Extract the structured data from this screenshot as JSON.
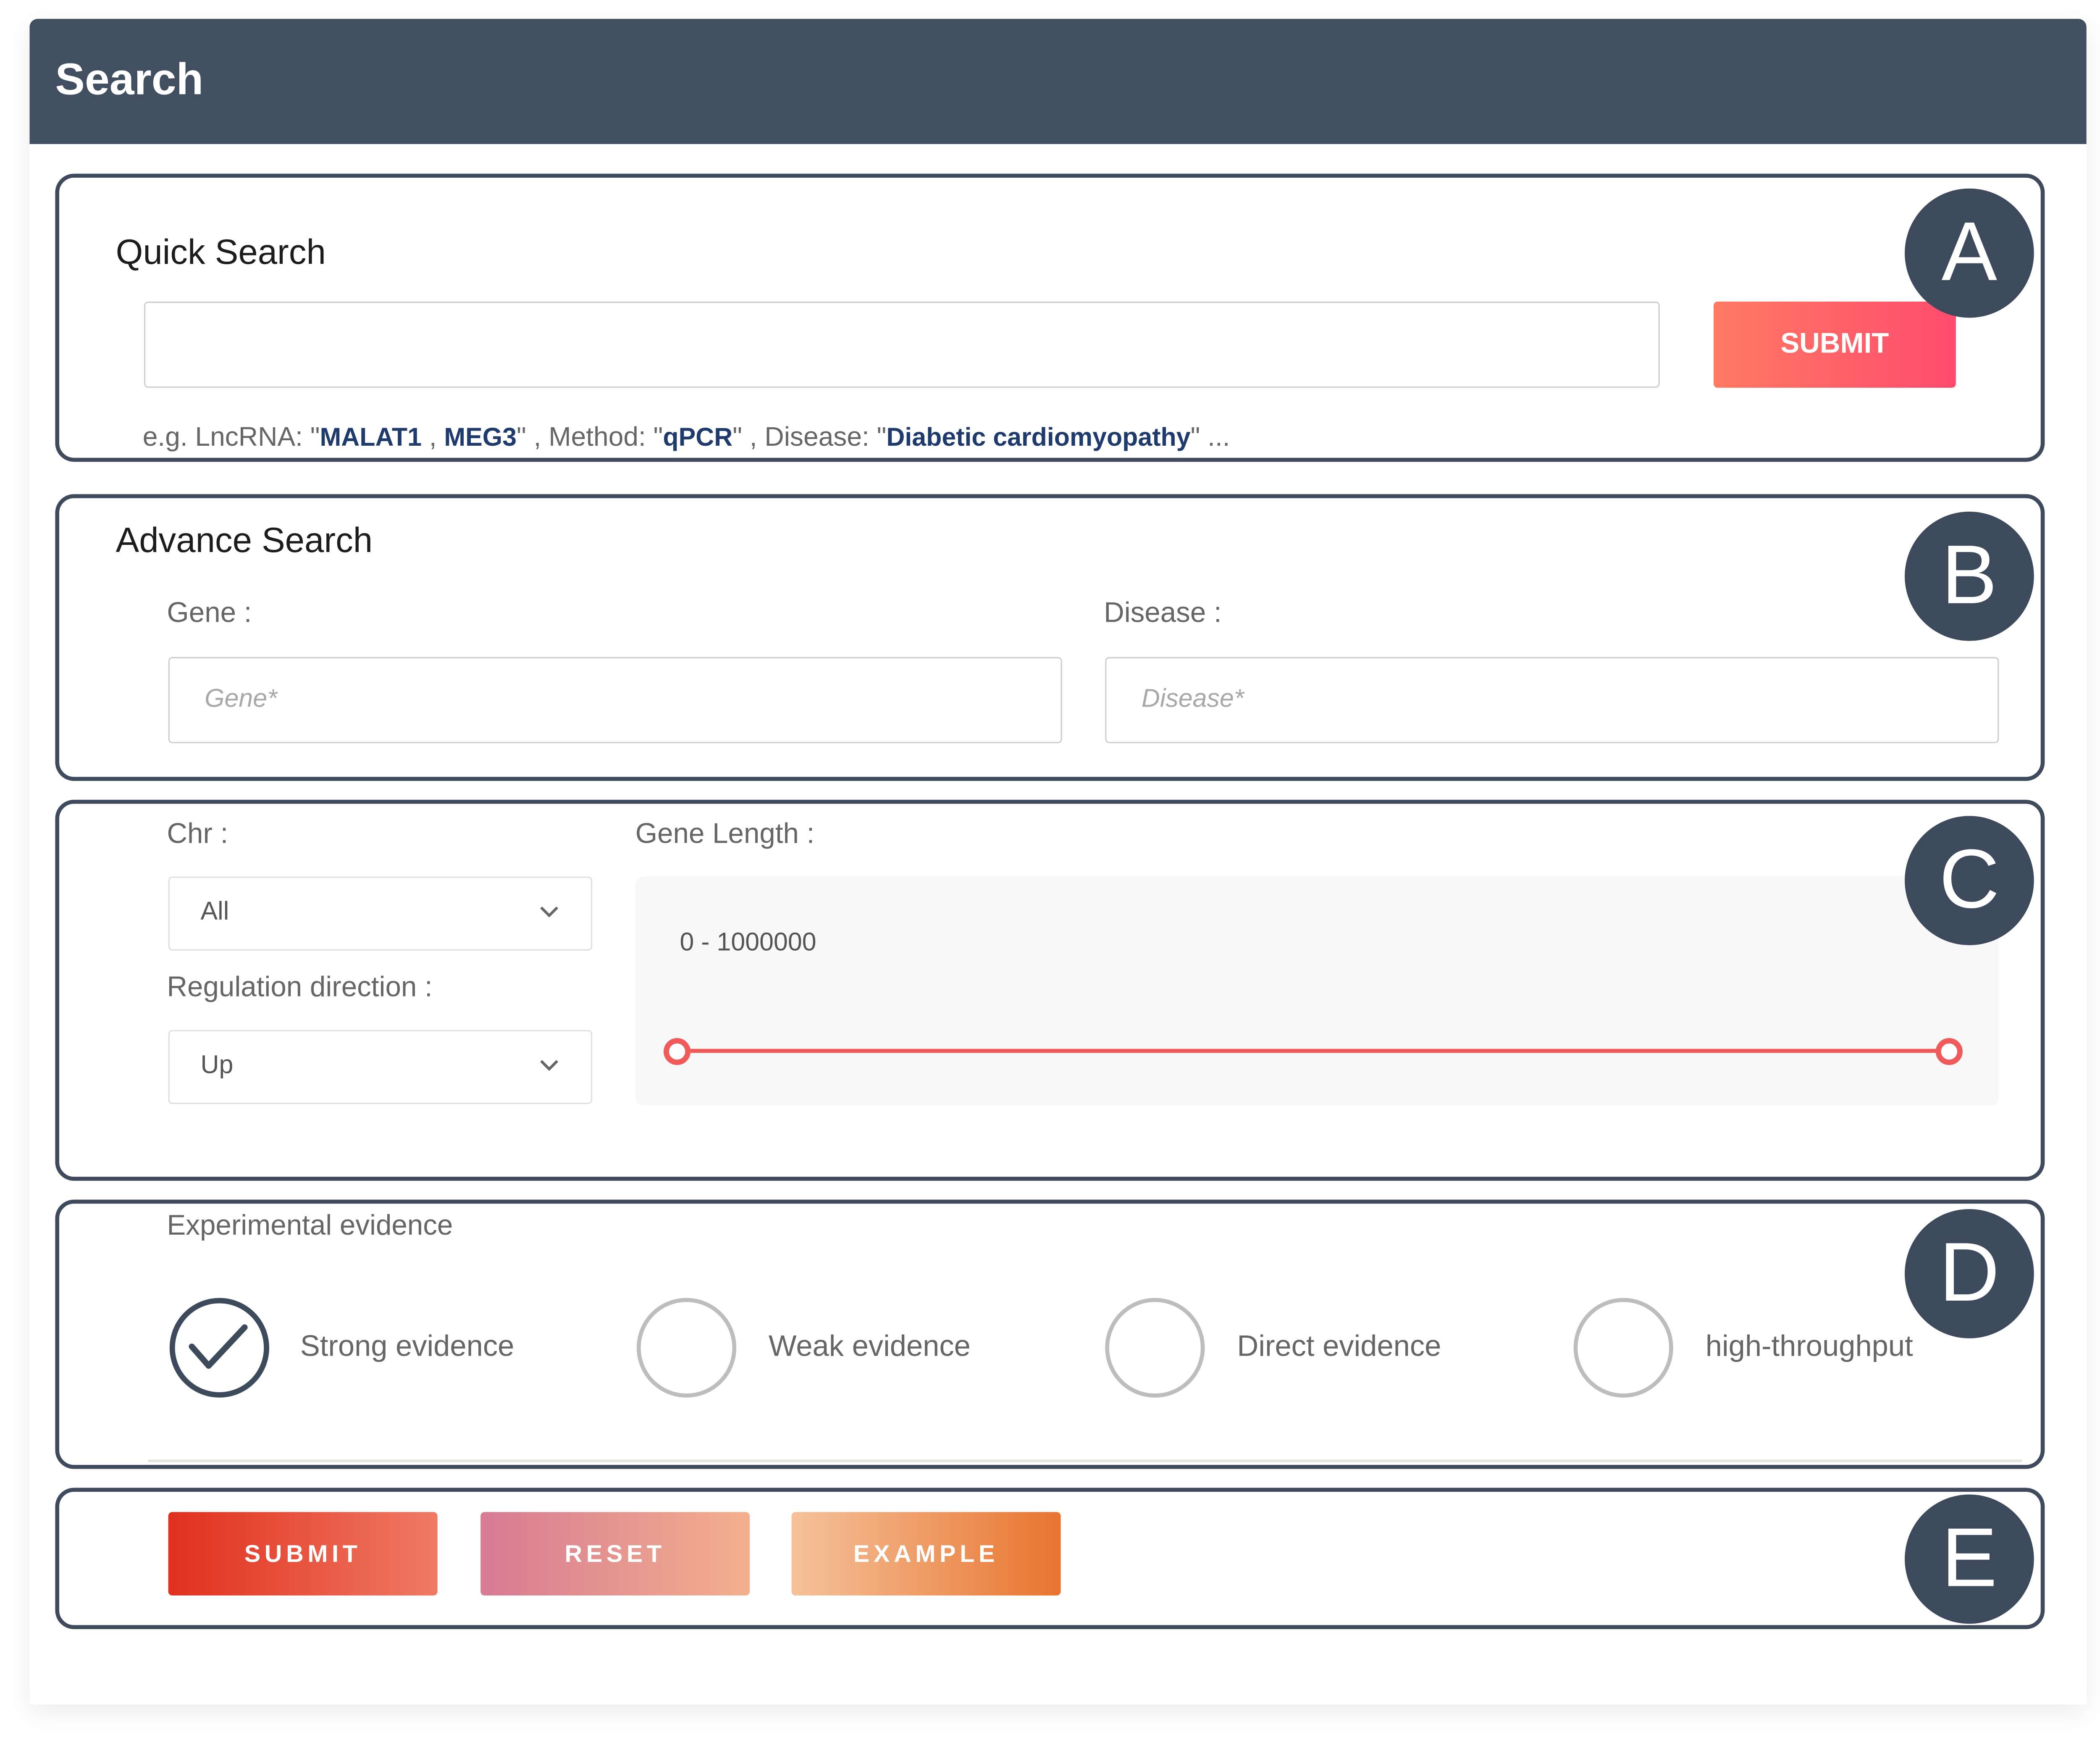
{
  "header": {
    "title": "Search"
  },
  "quick_search": {
    "title": "Quick Search",
    "input_value": "",
    "submit_label": "SUBMIT",
    "example": {
      "prefix": "e.g. LncRNA: \"",
      "lnc1": "MALAT1",
      "sep1": " , ",
      "lnc2": "MEG3",
      "mid1": "\" , Method: \"",
      "method": "qPCR",
      "mid2": "\" , Disease: \"",
      "disease": "Diabetic cardiomyopathy",
      "suffix": "\" ..."
    },
    "badge": "A",
    "submit_color_from": "#ff7a63",
    "submit_color_to": "#ff4b6e"
  },
  "advance_search": {
    "title": "Advance Search",
    "gene_label": "Gene :",
    "gene_placeholder": "Gene*",
    "disease_label": "Disease :",
    "disease_placeholder": "Disease*",
    "badge": "B"
  },
  "filters": {
    "chr_label": "Chr :",
    "chr_value": "All",
    "regulation_label": "Regulation direction :",
    "regulation_value": "Up",
    "gene_length_label": "Gene Length :",
    "gene_length_range_text": "0 - 1000000",
    "gene_length_min": 0,
    "gene_length_max": 1000000,
    "slider_low": 0,
    "slider_high": 1.0,
    "slider_color": "#f05a5a",
    "badge": "C"
  },
  "evidence": {
    "title": "Experimental evidence",
    "options": [
      {
        "label": "Strong evidence",
        "checked": true
      },
      {
        "label": "Weak evidence",
        "checked": false
      },
      {
        "label": "Direct evidence",
        "checked": false
      },
      {
        "label": "high-throughput",
        "checked": false
      }
    ],
    "badge": "D"
  },
  "actions": {
    "submit_label": "SUBMIT",
    "reset_label": "RESET",
    "example_label": "EXAMPLE",
    "badge": "E"
  },
  "colors": {
    "header_bg": "#424f60",
    "badge_bg": "#3d4a5c",
    "link_text": "#1f3b6e"
  },
  "icons": {
    "select_arrow": "chevron-down-icon",
    "checked_mark": "checkmark-icon"
  }
}
